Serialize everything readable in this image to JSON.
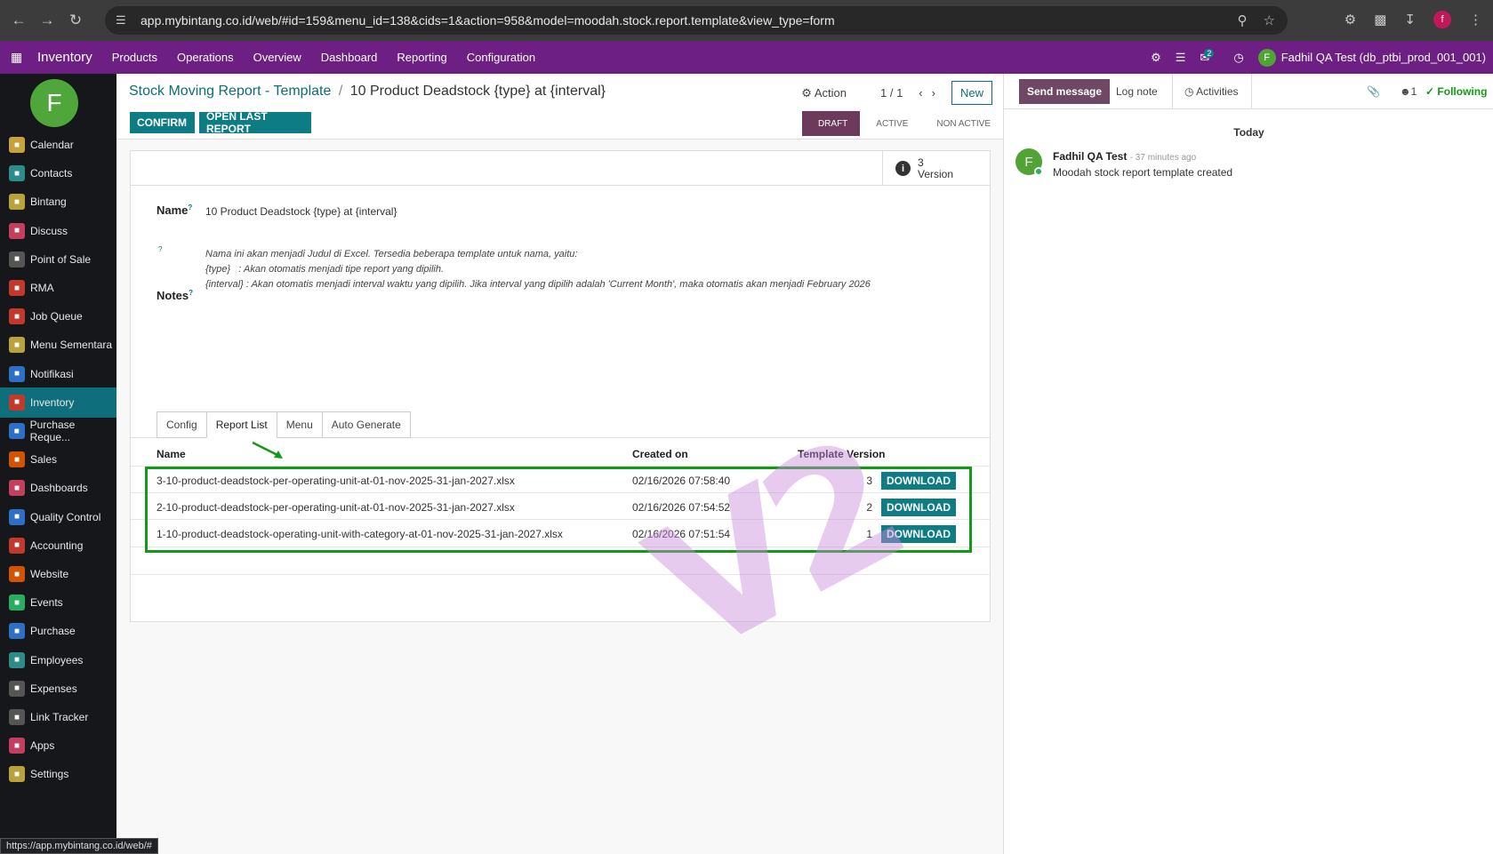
{
  "browser": {
    "url": "app.mybintang.co.id/web/#id=159&menu_id=138&cids=1&action=958&model=moodah.stock.report.template&view_type=form",
    "profile_initial": "f",
    "status_url": "https://app.mybintang.co.id/web/#"
  },
  "topnav": {
    "app_name": "Inventory",
    "menu": [
      "Products",
      "Operations",
      "Overview",
      "Dashboard",
      "Reporting",
      "Configuration"
    ],
    "chat_badge": "2",
    "user_initial": "F",
    "user_name": "Fadhil QA Test (db_ptbi_prod_001_001)",
    "bg_color": "#6e1f84"
  },
  "sidebar": {
    "avatar_initial": "F",
    "items": [
      {
        "label": "Calendar",
        "icon": "calendar-icon",
        "color": "#c7a23b"
      },
      {
        "label": "Contacts",
        "icon": "contacts-icon",
        "color": "#2c8c8a"
      },
      {
        "label": "Bintang",
        "icon": "gear-icon",
        "color": "#b9a23c"
      },
      {
        "label": "Discuss",
        "icon": "chat-icon",
        "color": "#c43f5e"
      },
      {
        "label": "Point of Sale",
        "icon": "shop-icon",
        "color": "#555555"
      },
      {
        "label": "RMA",
        "icon": "rma-icon",
        "color": "#c0392b"
      },
      {
        "label": "Job Queue",
        "icon": "list-icon",
        "color": "#c0392b"
      },
      {
        "label": "Menu Sementara",
        "icon": "gear-icon",
        "color": "#b9a23c"
      },
      {
        "label": "Notifikasi",
        "icon": "bell-icon",
        "color": "#2d6fc4"
      },
      {
        "label": "Inventory",
        "icon": "box-icon",
        "color": "#c0392b"
      },
      {
        "label": "Purchase Reque...",
        "icon": "cart-icon",
        "color": "#2d6fc4"
      },
      {
        "label": "Sales",
        "icon": "chart-icon",
        "color": "#d35400"
      },
      {
        "label": "Dashboards",
        "icon": "dashboard-icon",
        "color": "#c43f5e"
      },
      {
        "label": "Quality Control",
        "icon": "quality-icon",
        "color": "#2d6fc4"
      },
      {
        "label": "Accounting",
        "icon": "accounting-icon",
        "color": "#c0392b"
      },
      {
        "label": "Website",
        "icon": "globe-icon",
        "color": "#d35400"
      },
      {
        "label": "Events",
        "icon": "ticket-icon",
        "color": "#27ae60"
      },
      {
        "label": "Purchase",
        "icon": "purchase-icon",
        "color": "#2d6fc4"
      },
      {
        "label": "Employees",
        "icon": "people-icon",
        "color": "#2c8c8a"
      },
      {
        "label": "Expenses",
        "icon": "expense-icon",
        "color": "#555555"
      },
      {
        "label": "Link Tracker",
        "icon": "link-icon",
        "color": "#555555"
      },
      {
        "label": "Apps",
        "icon": "apps-icon",
        "color": "#c43f5e"
      },
      {
        "label": "Settings",
        "icon": "gear-icon",
        "color": "#b9a23c"
      }
    ],
    "active": "Inventory"
  },
  "control": {
    "breadcrumb_parent": "Stock Moving Report - Template",
    "breadcrumb_sep": "/",
    "breadcrumb_current": "10 Product Deadstock {type} at {interval}",
    "action_label": "Action",
    "pager": "1 / 1",
    "new_label": "New",
    "confirm_label": "CONFIRM",
    "open_last_label": "OPEN LAST REPORT",
    "statuses": [
      "DRAFT",
      "ACTIVE",
      "NON ACTIVE"
    ],
    "active_status": "DRAFT"
  },
  "sheet": {
    "smart_count": "3",
    "smart_label": "Version",
    "name_label": "Name",
    "name_value": "10 Product Deadstock {type} at {interval}",
    "help_lines": [
      "Nama ini akan menjadi Judul di Excel. Tersedia beberapa template untuk nama, yaitu:",
      "{type}   : Akan otomatis menjadi tipe report yang dipilih.",
      "{interval} : Akan otomatis menjadi interval waktu yang dipilih. Jika interval yang dipilih adalah 'Current Month', maka otomatis akan menjadi February 2026"
    ],
    "notes_label": "Notes",
    "tabs": [
      "Config",
      "Report List",
      "Menu",
      "Auto Generate"
    ],
    "active_tab": "Report List",
    "columns": [
      "Name",
      "Created on",
      "Template Version"
    ],
    "rows": [
      {
        "name": "3-10-product-deadstock-per-operating-unit-at-01-nov-2025-31-jan-2027.xlsx",
        "created": "02/16/2026 07:58:40",
        "version": "3"
      },
      {
        "name": "2-10-product-deadstock-per-operating-unit-at-01-nov-2025-31-jan-2027.xlsx",
        "created": "02/16/2026 07:54:52",
        "version": "2"
      },
      {
        "name": "1-10-product-deadstock-operating-unit-with-category-at-01-nov-2025-31-jan-2027.xlsx",
        "created": "02/16/2026 07:51:54",
        "version": "1"
      }
    ],
    "download_label": "DOWNLOAD",
    "watermark": "V2"
  },
  "chatter": {
    "send_label": "Send message",
    "log_label": "Log note",
    "activities_label": "Activities",
    "followers": "1",
    "following_label": "Following",
    "today_label": "Today",
    "author_initial": "F",
    "author": "Fadhil QA Test",
    "time": "- 37 minutes ago",
    "body": "Moodah stock report template created"
  }
}
